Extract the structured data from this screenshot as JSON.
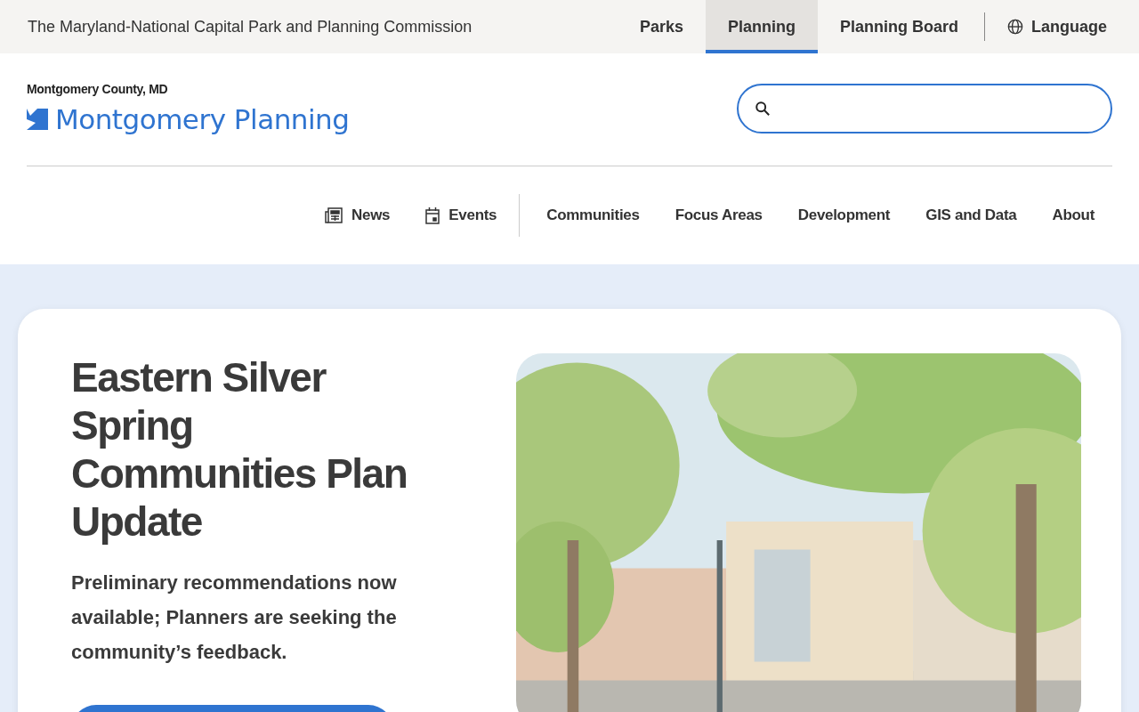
{
  "top_bar": {
    "title": "The Maryland-National Capital Park and Planning Commission",
    "links": [
      {
        "label": "Parks",
        "selected": false
      },
      {
        "label": "Planning",
        "selected": true
      },
      {
        "label": "Planning Board",
        "selected": false
      }
    ],
    "language": "Language"
  },
  "header": {
    "county": "Montgomery County, MD",
    "logo_text": "Montgomery Planning"
  },
  "nav": {
    "utility": [
      {
        "label": "News",
        "kind": "news"
      },
      {
        "label": "Events",
        "kind": "events"
      }
    ],
    "main": [
      "Communities",
      "Focus Areas",
      "Development",
      "GIS and Data",
      "About"
    ]
  },
  "hero": {
    "title": "Eastern Silver Spring Communities Plan Update",
    "subtitle": "Preliminary recommendations now available; Planners are seeking the community’s feedback."
  }
}
